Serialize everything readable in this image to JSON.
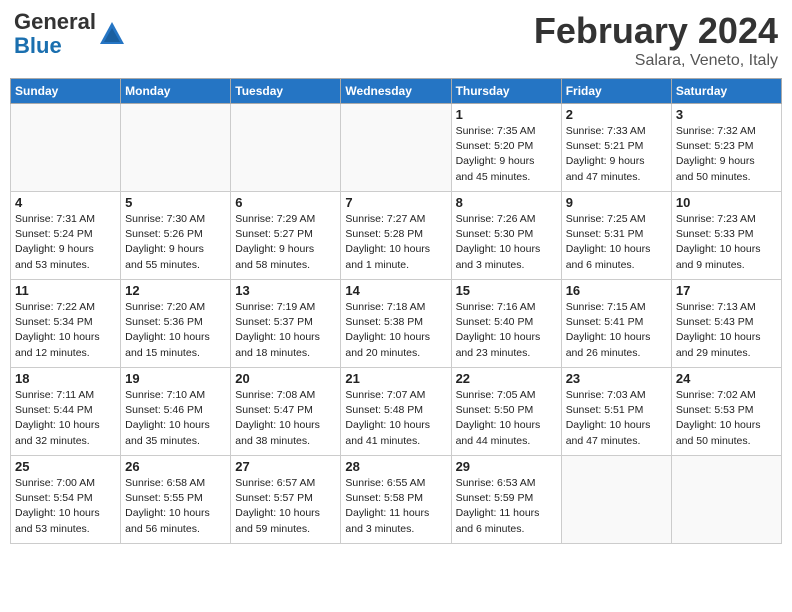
{
  "header": {
    "logo_line1": "General",
    "logo_line2": "Blue",
    "month": "February 2024",
    "location": "Salara, Veneto, Italy"
  },
  "weekdays": [
    "Sunday",
    "Monday",
    "Tuesday",
    "Wednesday",
    "Thursday",
    "Friday",
    "Saturday"
  ],
  "weeks": [
    [
      {
        "day": "",
        "info": ""
      },
      {
        "day": "",
        "info": ""
      },
      {
        "day": "",
        "info": ""
      },
      {
        "day": "",
        "info": ""
      },
      {
        "day": "1",
        "info": "Sunrise: 7:35 AM\nSunset: 5:20 PM\nDaylight: 9 hours\nand 45 minutes."
      },
      {
        "day": "2",
        "info": "Sunrise: 7:33 AM\nSunset: 5:21 PM\nDaylight: 9 hours\nand 47 minutes."
      },
      {
        "day": "3",
        "info": "Sunrise: 7:32 AM\nSunset: 5:23 PM\nDaylight: 9 hours\nand 50 minutes."
      }
    ],
    [
      {
        "day": "4",
        "info": "Sunrise: 7:31 AM\nSunset: 5:24 PM\nDaylight: 9 hours\nand 53 minutes."
      },
      {
        "day": "5",
        "info": "Sunrise: 7:30 AM\nSunset: 5:26 PM\nDaylight: 9 hours\nand 55 minutes."
      },
      {
        "day": "6",
        "info": "Sunrise: 7:29 AM\nSunset: 5:27 PM\nDaylight: 9 hours\nand 58 minutes."
      },
      {
        "day": "7",
        "info": "Sunrise: 7:27 AM\nSunset: 5:28 PM\nDaylight: 10 hours\nand 1 minute."
      },
      {
        "day": "8",
        "info": "Sunrise: 7:26 AM\nSunset: 5:30 PM\nDaylight: 10 hours\nand 3 minutes."
      },
      {
        "day": "9",
        "info": "Sunrise: 7:25 AM\nSunset: 5:31 PM\nDaylight: 10 hours\nand 6 minutes."
      },
      {
        "day": "10",
        "info": "Sunrise: 7:23 AM\nSunset: 5:33 PM\nDaylight: 10 hours\nand 9 minutes."
      }
    ],
    [
      {
        "day": "11",
        "info": "Sunrise: 7:22 AM\nSunset: 5:34 PM\nDaylight: 10 hours\nand 12 minutes."
      },
      {
        "day": "12",
        "info": "Sunrise: 7:20 AM\nSunset: 5:36 PM\nDaylight: 10 hours\nand 15 minutes."
      },
      {
        "day": "13",
        "info": "Sunrise: 7:19 AM\nSunset: 5:37 PM\nDaylight: 10 hours\nand 18 minutes."
      },
      {
        "day": "14",
        "info": "Sunrise: 7:18 AM\nSunset: 5:38 PM\nDaylight: 10 hours\nand 20 minutes."
      },
      {
        "day": "15",
        "info": "Sunrise: 7:16 AM\nSunset: 5:40 PM\nDaylight: 10 hours\nand 23 minutes."
      },
      {
        "day": "16",
        "info": "Sunrise: 7:15 AM\nSunset: 5:41 PM\nDaylight: 10 hours\nand 26 minutes."
      },
      {
        "day": "17",
        "info": "Sunrise: 7:13 AM\nSunset: 5:43 PM\nDaylight: 10 hours\nand 29 minutes."
      }
    ],
    [
      {
        "day": "18",
        "info": "Sunrise: 7:11 AM\nSunset: 5:44 PM\nDaylight: 10 hours\nand 32 minutes."
      },
      {
        "day": "19",
        "info": "Sunrise: 7:10 AM\nSunset: 5:46 PM\nDaylight: 10 hours\nand 35 minutes."
      },
      {
        "day": "20",
        "info": "Sunrise: 7:08 AM\nSunset: 5:47 PM\nDaylight: 10 hours\nand 38 minutes."
      },
      {
        "day": "21",
        "info": "Sunrise: 7:07 AM\nSunset: 5:48 PM\nDaylight: 10 hours\nand 41 minutes."
      },
      {
        "day": "22",
        "info": "Sunrise: 7:05 AM\nSunset: 5:50 PM\nDaylight: 10 hours\nand 44 minutes."
      },
      {
        "day": "23",
        "info": "Sunrise: 7:03 AM\nSunset: 5:51 PM\nDaylight: 10 hours\nand 47 minutes."
      },
      {
        "day": "24",
        "info": "Sunrise: 7:02 AM\nSunset: 5:53 PM\nDaylight: 10 hours\nand 50 minutes."
      }
    ],
    [
      {
        "day": "25",
        "info": "Sunrise: 7:00 AM\nSunset: 5:54 PM\nDaylight: 10 hours\nand 53 minutes."
      },
      {
        "day": "26",
        "info": "Sunrise: 6:58 AM\nSunset: 5:55 PM\nDaylight: 10 hours\nand 56 minutes."
      },
      {
        "day": "27",
        "info": "Sunrise: 6:57 AM\nSunset: 5:57 PM\nDaylight: 10 hours\nand 59 minutes."
      },
      {
        "day": "28",
        "info": "Sunrise: 6:55 AM\nSunset: 5:58 PM\nDaylight: 11 hours\nand 3 minutes."
      },
      {
        "day": "29",
        "info": "Sunrise: 6:53 AM\nSunset: 5:59 PM\nDaylight: 11 hours\nand 6 minutes."
      },
      {
        "day": "",
        "info": ""
      },
      {
        "day": "",
        "info": ""
      }
    ]
  ]
}
